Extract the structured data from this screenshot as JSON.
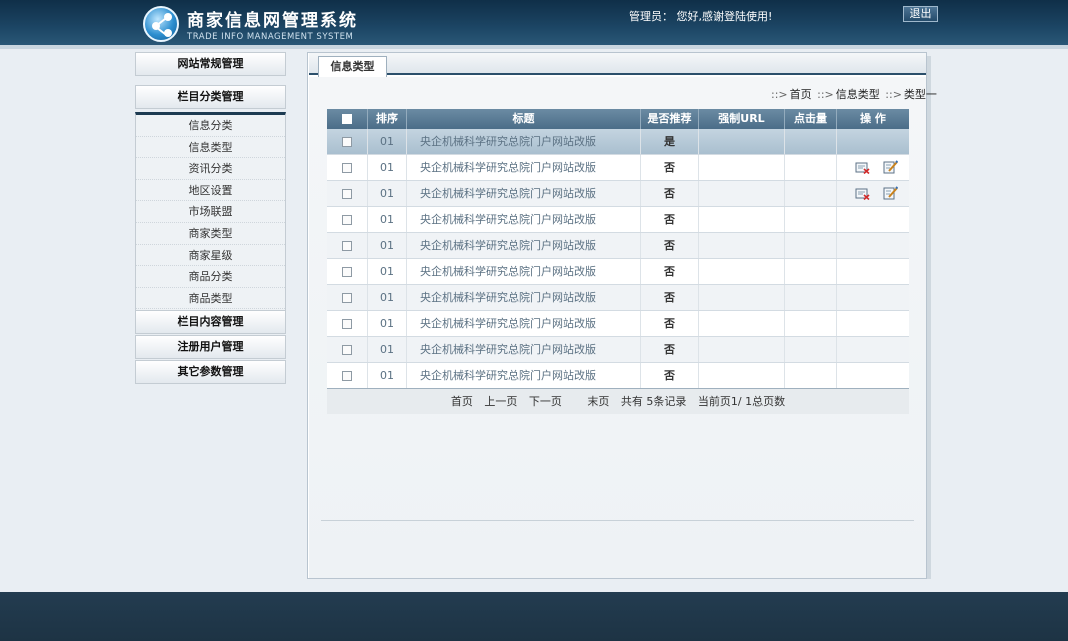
{
  "header": {
    "title": "商家信息网管理系统",
    "subtitle": "TRADE INFO MANAGEMENT SYSTEM",
    "greeting": "管理员： 您好,感谢登陆使用!",
    "logout": "退出"
  },
  "sidebar": {
    "site_general": "网站常规管理",
    "category_mgmt": "栏目分类管理",
    "sub_items": [
      "信息分类",
      "信息类型",
      "资讯分类",
      "地区设置",
      "市场联盟",
      "商家类型",
      "商家星级",
      "商品分类",
      "商品类型"
    ],
    "content_mgmt": "栏目内容管理",
    "user_mgmt": "注册用户管理",
    "other_mgmt": "其它参数管理"
  },
  "tab": {
    "label": "信息类型"
  },
  "breadcrumb": {
    "home": "首页",
    "level1": "信息类型",
    "level2": "类型一"
  },
  "table": {
    "headers": [
      "排序",
      "标题",
      "是否推荐",
      "强制URL",
      "点击量",
      "操 作"
    ],
    "rows": [
      {
        "order": "01",
        "title": "央企机械科学研究总院门户网站改版",
        "recommend": "是"
      },
      {
        "order": "01",
        "title": "央企机械科学研究总院门户网站改版",
        "recommend": "否"
      },
      {
        "order": "01",
        "title": "央企机械科学研究总院门户网站改版",
        "recommend": "否"
      },
      {
        "order": "01",
        "title": "央企机械科学研究总院门户网站改版",
        "recommend": "否"
      },
      {
        "order": "01",
        "title": "央企机械科学研究总院门户网站改版",
        "recommend": "否"
      },
      {
        "order": "01",
        "title": "央企机械科学研究总院门户网站改版",
        "recommend": "否"
      },
      {
        "order": "01",
        "title": "央企机械科学研究总院门户网站改版",
        "recommend": "否"
      },
      {
        "order": "01",
        "title": "央企机械科学研究总院门户网站改版",
        "recommend": "否"
      },
      {
        "order": "01",
        "title": "央企机械科学研究总院门户网站改版",
        "recommend": "否"
      },
      {
        "order": "01",
        "title": "央企机械科学研究总院门户网站改版",
        "recommend": "否"
      }
    ],
    "actions_on_rows": [
      1,
      2
    ]
  },
  "pager": {
    "first": "首页",
    "prev": "上一页",
    "next": "下一页",
    "last": "末页",
    "total": "共有  5条记录",
    "current": "当前页1/  1总页数"
  },
  "colors": {
    "header_bg": "#1c4564",
    "table_head": "#5b7c96",
    "footer_bg": "#1f3749"
  },
  "icons": {
    "delete": "delete-icon",
    "edit": "edit-icon"
  }
}
